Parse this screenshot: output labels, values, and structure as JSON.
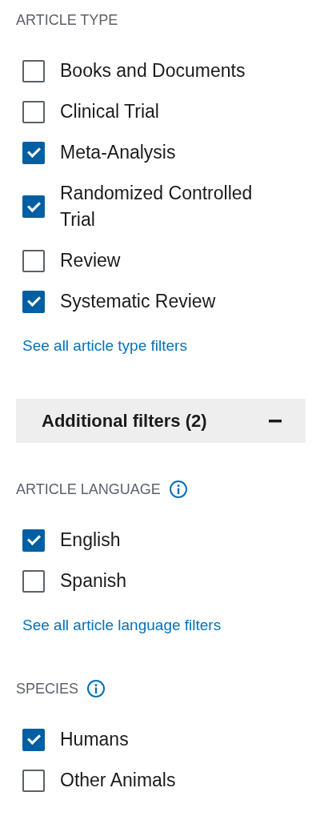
{
  "blocks": [
    {
      "kind": "filter",
      "heading": "ARTICLE TYPE",
      "info": false,
      "options": [
        {
          "label": "Books and Documents",
          "checked": false
        },
        {
          "label": "Clinical Trial",
          "checked": false
        },
        {
          "label": "Meta-Analysis",
          "checked": true
        },
        {
          "label": "Randomized Controlled Trial",
          "checked": true
        },
        {
          "label": "Review",
          "checked": false
        },
        {
          "label": "Systematic Review",
          "checked": true
        }
      ],
      "link": "See all article type filters"
    },
    {
      "kind": "toggle",
      "label": "Additional filters (2)",
      "expanded": true
    },
    {
      "kind": "filter",
      "heading": "ARTICLE LANGUAGE",
      "info": true,
      "options": [
        {
          "label": "English",
          "checked": true
        },
        {
          "label": "Spanish",
          "checked": false
        }
      ],
      "link": "See all article language filters"
    },
    {
      "kind": "filter",
      "heading": "SPECIES",
      "info": true,
      "options": [
        {
          "label": "Humans",
          "checked": true
        },
        {
          "label": "Other Animals",
          "checked": false
        }
      ]
    }
  ]
}
